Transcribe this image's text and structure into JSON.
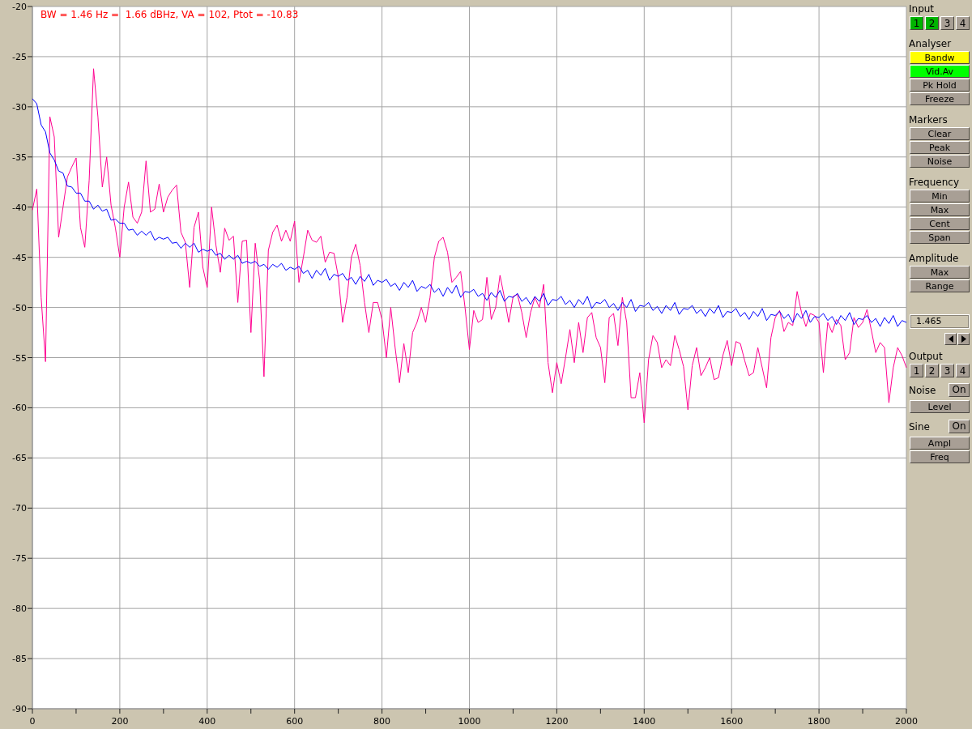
{
  "chart": {
    "readout": "BW = 1.46 Hz =  1.66 dBHz, VA = 102, Ptot = -10.83",
    "chart_data": {
      "type": "line",
      "grid": true,
      "xlim": [
        0,
        2000
      ],
      "ylim": [
        -90,
        -20
      ],
      "xticks": [
        0,
        200,
        400,
        600,
        800,
        1000,
        1200,
        1400,
        1600,
        1800,
        2000
      ],
      "yticks": [
        -90,
        -85,
        -80,
        -75,
        -70,
        -65,
        -60,
        -55,
        -50,
        -45,
        -40,
        -35,
        -30,
        -25,
        -20
      ],
      "x": [
        0,
        10,
        20,
        30,
        40,
        50,
        60,
        70,
        80,
        90,
        100,
        110,
        120,
        130,
        140,
        150,
        160,
        170,
        180,
        190,
        200,
        210,
        220,
        230,
        240,
        250,
        260,
        270,
        280,
        290,
        300,
        310,
        320,
        330,
        340,
        350,
        360,
        370,
        380,
        390,
        400,
        410,
        420,
        430,
        440,
        450,
        460,
        470,
        480,
        490,
        500,
        510,
        520,
        530,
        540,
        550,
        560,
        570,
        580,
        590,
        600,
        610,
        620,
        630,
        640,
        650,
        660,
        670,
        680,
        690,
        700,
        710,
        720,
        730,
        740,
        750,
        760,
        770,
        780,
        790,
        800,
        810,
        820,
        830,
        840,
        850,
        860,
        870,
        880,
        890,
        900,
        910,
        920,
        930,
        940,
        950,
        960,
        970,
        980,
        990,
        1000,
        1010,
        1020,
        1030,
        1040,
        1050,
        1060,
        1070,
        1080,
        1090,
        1100,
        1110,
        1120,
        1130,
        1140,
        1150,
        1160,
        1170,
        1180,
        1190,
        1200,
        1210,
        1220,
        1230,
        1240,
        1250,
        1260,
        1270,
        1280,
        1290,
        1300,
        1310,
        1320,
        1330,
        1340,
        1350,
        1360,
        1370,
        1380,
        1390,
        1400,
        1410,
        1420,
        1430,
        1440,
        1450,
        1460,
        1470,
        1480,
        1490,
        1500,
        1510,
        1520,
        1530,
        1540,
        1550,
        1560,
        1570,
        1580,
        1590,
        1600,
        1610,
        1620,
        1630,
        1640,
        1650,
        1660,
        1670,
        1680,
        1690,
        1700,
        1710,
        1720,
        1730,
        1740,
        1750,
        1760,
        1770,
        1780,
        1790,
        1800,
        1810,
        1820,
        1830,
        1840,
        1850,
        1860,
        1870,
        1880,
        1890,
        1900,
        1910,
        1920,
        1930,
        1940,
        1950,
        1960,
        1970,
        1980,
        1990,
        2000
      ],
      "series": [
        {
          "color": "#ff0090",
          "values": [
            -40.3,
            -38.2,
            -49,
            -55.4,
            -31,
            -33,
            -43,
            -40,
            -37,
            -36,
            -35.1,
            -42,
            -44,
            -37.3,
            -26.2,
            -31,
            -38,
            -35,
            -39.8,
            -42.1,
            -45,
            -40,
            -37.5,
            -41,
            -41.6,
            -40.5,
            -35.4,
            -40.5,
            -40.2,
            -37.7,
            -40.5,
            -39,
            -38.3,
            -37.8,
            -42.5,
            -43.5,
            -48,
            -42,
            -40.5,
            -46,
            -48,
            -40,
            -43.8,
            -46.5,
            -42.1,
            -43.3,
            -42.9,
            -49.5,
            -43.4,
            -43.3,
            -52.5,
            -43.6,
            -47.3,
            -56.9,
            -44.3,
            -42.5,
            -41.8,
            -43.4,
            -42.3,
            -43.4,
            -41.4,
            -47.5,
            -45,
            -42.3,
            -43.3,
            -43.5,
            -42.9,
            -45.5,
            -44.5,
            -44.6,
            -46.9,
            -51.5,
            -49,
            -45,
            -43.7,
            -45.8,
            -49.5,
            -52.5,
            -49.5,
            -49.5,
            -51.2,
            -55,
            -50,
            -54,
            -57.5,
            -53.6,
            -56.5,
            -52.5,
            -51.5,
            -50,
            -51.5,
            -49,
            -45,
            -43.4,
            -43,
            -44.5,
            -47.5,
            -47,
            -46.4,
            -50,
            -54.2,
            -50.3,
            -51.5,
            -51.2,
            -47,
            -51.2,
            -50,
            -46.8,
            -49,
            -51.5,
            -48.9,
            -48.7,
            -50.5,
            -53,
            -50.5,
            -49,
            -50,
            -47.7,
            -55.5,
            -58.5,
            -55.5,
            -57.6,
            -55,
            -52.2,
            -55.5,
            -51.5,
            -54.5,
            -51,
            -50.5,
            -53,
            -54,
            -57.5,
            -51,
            -50.6,
            -53.8,
            -49,
            -51.5,
            -59,
            -59,
            -56.5,
            -61.5,
            -55.2,
            -52.8,
            -53.5,
            -56,
            -55.2,
            -55.8,
            -52.8,
            -54.2,
            -55.9,
            -60.2,
            -55.8,
            -54,
            -56.8,
            -56,
            -55,
            -57.2,
            -57,
            -54.8,
            -53.3,
            -55.8,
            -53.4,
            -53.6,
            -55.3,
            -56.8,
            -56.5,
            -54,
            -56,
            -58,
            -53,
            -51,
            -50.3,
            -52.4,
            -51.5,
            -51.8,
            -48.4,
            -50.5,
            -51.9,
            -50.6,
            -50.8,
            -51.5,
            -56.5,
            -51.5,
            -52.5,
            -51.2,
            -51.8,
            -55.2,
            -54.5,
            -51,
            -52,
            -51.5,
            -50.2,
            -52.3,
            -54.5,
            -53.5,
            -54,
            -59.5,
            -56,
            -54,
            -54.8,
            -56
          ]
        },
        {
          "color": "#0000ff",
          "values": [
            -29.2,
            -29.7,
            -31.8,
            -32.5,
            -34.6,
            -35.3,
            -36.4,
            -36.6,
            -37.9,
            -38.0,
            -38.6,
            -38.6,
            -39.4,
            -39.4,
            -40.2,
            -39.8,
            -40.4,
            -40.2,
            -41.3,
            -41.2,
            -41.6,
            -41.6,
            -42.3,
            -42.2,
            -42.8,
            -42.4,
            -42.8,
            -42.4,
            -43.3,
            -43.0,
            -43.2,
            -43.0,
            -43.6,
            -43.5,
            -44.1,
            -43.6,
            -44.0,
            -43.6,
            -44.5,
            -44.2,
            -44.4,
            -44.2,
            -44.8,
            -44.6,
            -45.2,
            -44.8,
            -45.2,
            -44.8,
            -45.6,
            -45.4,
            -45.6,
            -45.4,
            -45.9,
            -45.7,
            -46.2,
            -45.7,
            -46.0,
            -45.6,
            -46.3,
            -46.0,
            -46.2,
            -45.9,
            -46.6,
            -46.3,
            -47.1,
            -46.3,
            -46.8,
            -46.1,
            -47.3,
            -46.7,
            -46.9,
            -46.6,
            -47.3,
            -47.0,
            -47.7,
            -46.9,
            -47.4,
            -46.7,
            -47.8,
            -47.3,
            -47.5,
            -47.2,
            -47.9,
            -47.6,
            -48.3,
            -47.5,
            -48.0,
            -47.3,
            -48.4,
            -47.9,
            -48.1,
            -47.7,
            -48.5,
            -48.1,
            -48.9,
            -48.0,
            -48.6,
            -47.8,
            -49.0,
            -48.4,
            -48.5,
            -48.2,
            -48.9,
            -48.6,
            -49.3,
            -48.5,
            -49.0,
            -48.3,
            -49.4,
            -48.9,
            -49.0,
            -48.6,
            -49.4,
            -49.0,
            -49.7,
            -48.9,
            -49.4,
            -48.6,
            -49.8,
            -49.2,
            -49.3,
            -48.9,
            -49.7,
            -49.3,
            -50.0,
            -49.2,
            -49.7,
            -48.9,
            -50.1,
            -49.5,
            -49.6,
            -49.2,
            -50.0,
            -49.6,
            -50.3,
            -49.5,
            -50.0,
            -49.2,
            -50.4,
            -49.8,
            -49.9,
            -49.5,
            -50.3,
            -49.9,
            -50.6,
            -49.8,
            -50.3,
            -49.5,
            -50.7,
            -50.1,
            -50.2,
            -49.8,
            -50.6,
            -50.2,
            -50.9,
            -50.1,
            -50.6,
            -49.8,
            -51.0,
            -50.4,
            -50.5,
            -50.1,
            -50.9,
            -50.5,
            -51.2,
            -50.4,
            -50.9,
            -50.1,
            -51.3,
            -50.7,
            -50.8,
            -50.4,
            -51.1,
            -50.7,
            -51.5,
            -50.6,
            -51.1,
            -50.3,
            -51.5,
            -50.9,
            -51.0,
            -50.6,
            -51.3,
            -50.9,
            -51.7,
            -50.8,
            -51.3,
            -50.5,
            -51.7,
            -51.1,
            -51.2,
            -50.8,
            -51.5,
            -51.1,
            -51.9,
            -51.0,
            -51.6,
            -50.8,
            -51.9,
            -51.3,
            -51.5
          ]
        }
      ]
    }
  },
  "panel": {
    "sections": [
      {
        "kind": "channels",
        "label": "Input",
        "channels": [
          {
            "label": "1",
            "on": true
          },
          {
            "label": "2",
            "on": true
          },
          {
            "label": "3",
            "on": false
          },
          {
            "label": "4",
            "on": false
          }
        ]
      },
      {
        "kind": "buttons",
        "label": "Analyser",
        "buttons": [
          {
            "label": "Bandw",
            "on": true,
            "color": "#ffff00"
          },
          {
            "label": "Vid.Av",
            "on": true,
            "color": "#00ff00"
          },
          {
            "label": "Pk Hold",
            "on": false
          },
          {
            "label": "Freeze",
            "on": false
          }
        ]
      },
      {
        "kind": "buttons",
        "label": "Markers",
        "buttons": [
          {
            "label": "Clear",
            "on": false
          },
          {
            "label": "Peak",
            "on": false
          },
          {
            "label": "Noise",
            "on": false
          }
        ]
      },
      {
        "kind": "buttons",
        "label": "Frequency",
        "buttons": [
          {
            "label": "Min",
            "on": false
          },
          {
            "label": "Max",
            "on": false
          },
          {
            "label": "Cent",
            "on": false
          },
          {
            "label": "Span",
            "on": false
          }
        ]
      },
      {
        "kind": "buttons",
        "label": "Amplitude",
        "buttons": [
          {
            "label": "Max",
            "on": false
          },
          {
            "label": "Range",
            "on": false
          }
        ]
      },
      {
        "kind": "field",
        "value": "1.465"
      },
      {
        "kind": "channels",
        "label": "Output",
        "channels": [
          {
            "label": "1",
            "on": false
          },
          {
            "label": "2",
            "on": false
          },
          {
            "label": "3",
            "on": false
          },
          {
            "label": "4",
            "on": false
          }
        ]
      },
      {
        "kind": "switch",
        "label": "Noise",
        "switch": {
          "label": "On",
          "on": false
        },
        "buttons": [
          {
            "label": "Level",
            "on": false
          }
        ]
      },
      {
        "kind": "switch",
        "label": "Sine",
        "switch": {
          "label": "On",
          "on": false
        },
        "buttons": [
          {
            "label": "Ampl",
            "on": false
          },
          {
            "label": "Freq",
            "on": false
          }
        ]
      }
    ]
  }
}
